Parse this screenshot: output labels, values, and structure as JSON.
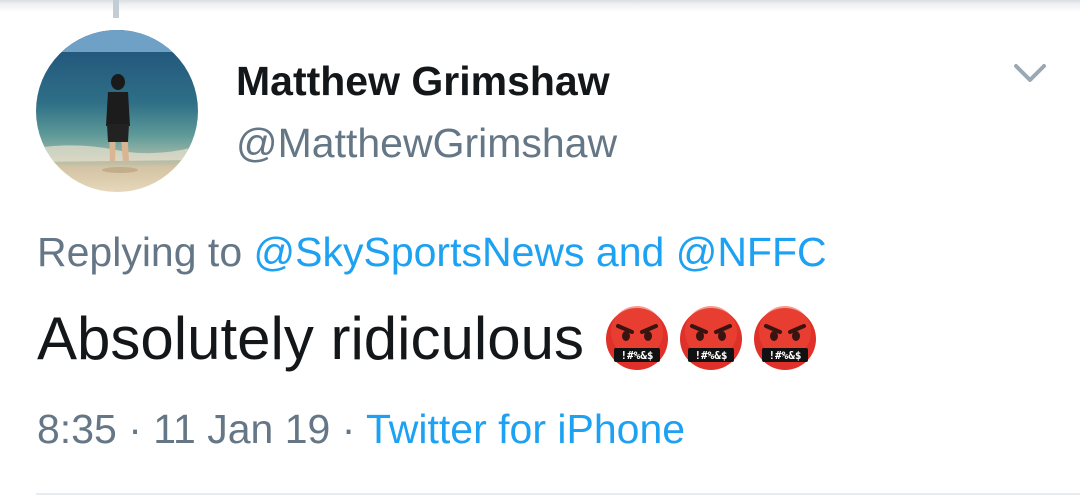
{
  "tweet": {
    "author_name": "Matthew Grimshaw",
    "author_handle": "@MatthewGrimshaw",
    "reply_prefix": "Replying to ",
    "reply_mention_1": "@SkySportsNews",
    "reply_joiner": " and ",
    "reply_mention_2": "@NFFC",
    "text": "Absolutely ridiculous",
    "emoji_symbols": "!#%&$",
    "emoji_name": "face-with-symbols-on-mouth",
    "time": "8:35",
    "separator": " · ",
    "date": "11 Jan 19",
    "source": "Twitter for iPhone"
  },
  "colors": {
    "text": "#14171a",
    "secondary": "#657786",
    "link": "#1da1f2",
    "emoji_face": "#e0302a"
  },
  "icons": {
    "menu": "chevron-down-icon",
    "avatar": "profile-photo-beach"
  }
}
